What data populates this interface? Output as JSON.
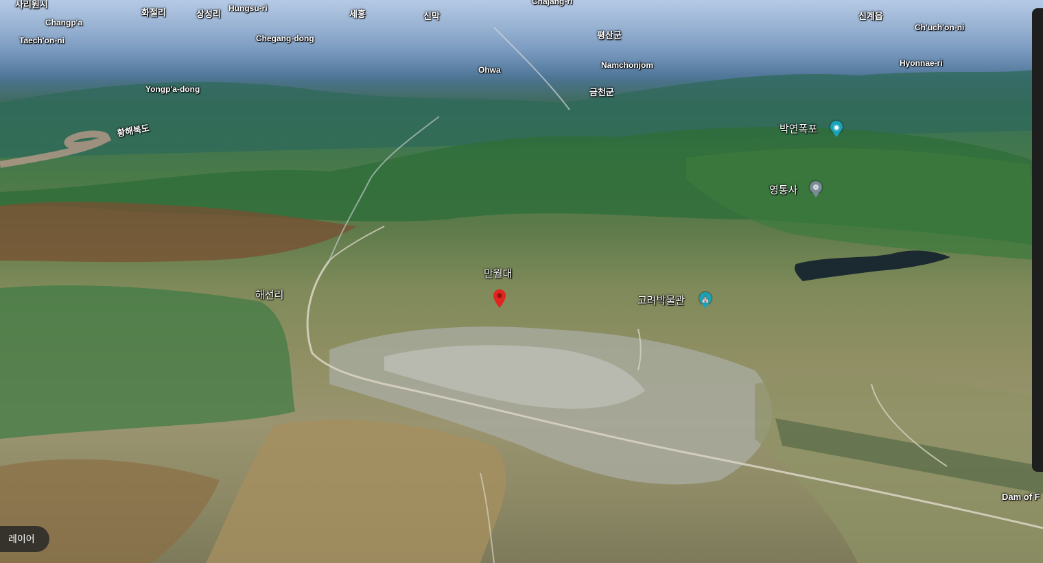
{
  "layer_button": {
    "label": "레이어"
  },
  "places": {
    "sariwon": "사리원시",
    "changpa": "Changp'a",
    "taechonni": "Taech'on-ni",
    "hwajeolli": "화절리",
    "sangseongni": "상성리",
    "hungsuri": "Hungsu-ri",
    "chegangdong": "Chegang-dong",
    "sehong": "세홍",
    "sinmak": "신막",
    "chajangri": "Chajang-ri",
    "pyeongsangun": "평산군",
    "singyeeup": "신계읍",
    "chuchonni": "Ch'uch'on-ni",
    "namchonjom": "Namchonjom",
    "ohwa": "Ohwa",
    "hyonnaeri": "Hyonnae-ri",
    "yongpadong": "Yongp'a-dong",
    "geumcheongun": "금천군",
    "hwanghaebukdo": "황해북도",
    "bakyeonpokpo": "박연폭포",
    "yeongtongsa": "영통사",
    "manwoldae": "만월대",
    "haeseonri": "해선리",
    "goryeo_museum": "고려박물관",
    "dam": "Dam of F"
  },
  "icons": {
    "waterfall": "camera-icon",
    "temple": "temple-icon",
    "museum": "museum-icon",
    "pin": "red-location-pin-icon"
  },
  "colors": {
    "teal_poi": "#1aa3b8",
    "grey_poi": "#7b8a97",
    "pin_red": "#e0261f"
  }
}
